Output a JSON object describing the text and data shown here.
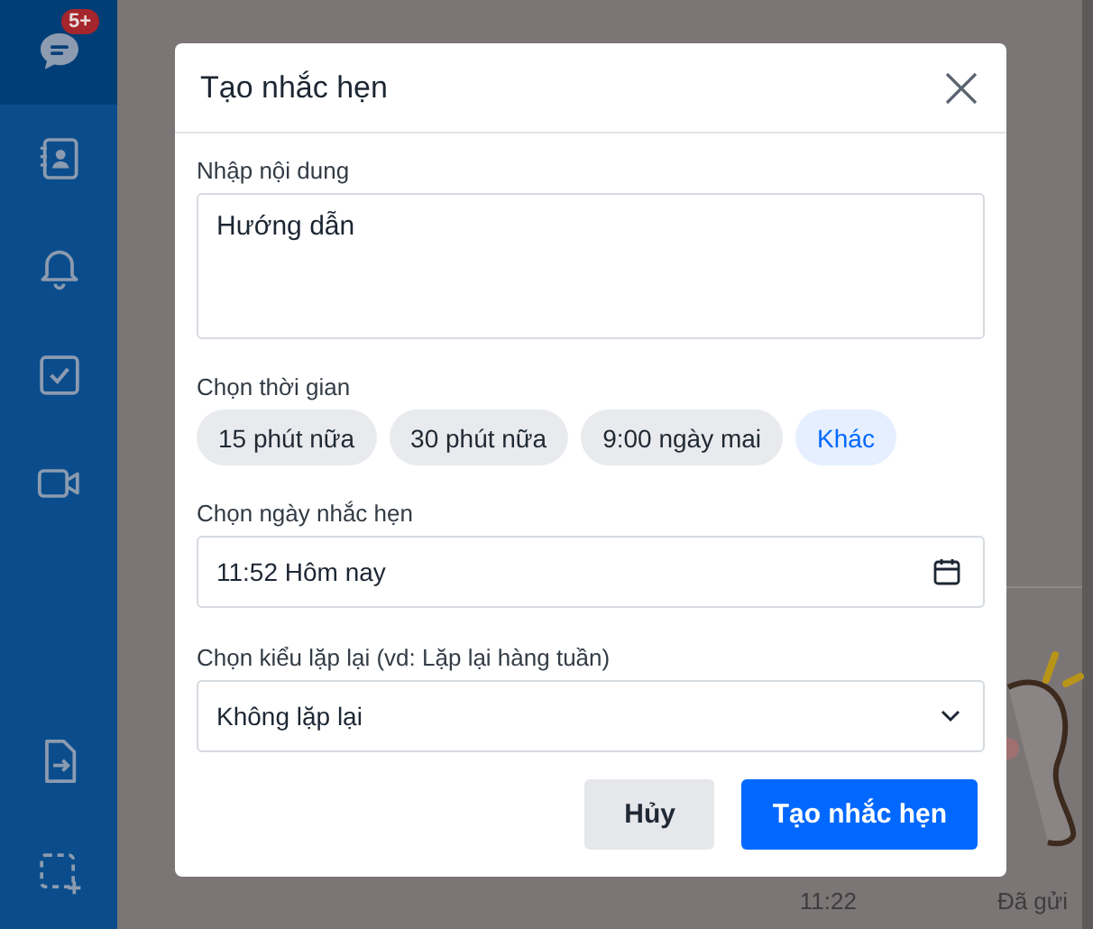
{
  "sidebar": {
    "top_items": [
      {
        "kind": "chat",
        "selected": true,
        "badge": "5+"
      },
      {
        "kind": "contacts",
        "selected": false
      },
      {
        "kind": "bell",
        "selected": false
      },
      {
        "kind": "todo",
        "selected": false
      },
      {
        "kind": "video",
        "selected": false
      }
    ],
    "bottom_items": [
      {
        "kind": "file",
        "selected": false
      },
      {
        "kind": "capture",
        "selected": false
      }
    ]
  },
  "chat": {
    "time": "11:22",
    "status": "Đã gửi"
  },
  "dialog": {
    "title": "Tạo nhắc hẹn",
    "content_label": "Nhập nội dung",
    "content_value": "Hướng dẫn",
    "time_label": "Chọn thời gian",
    "time_options": [
      {
        "label": "15 phút nữa",
        "selected": false
      },
      {
        "label": "30 phút nữa",
        "selected": false
      },
      {
        "label": "9:00 ngày mai",
        "selected": false
      },
      {
        "label": "Khác",
        "selected": true
      }
    ],
    "date_label": "Chọn ngày nhắc hẹn",
    "date_value": "11:52 Hôm nay",
    "repeat_label": "Chọn kiểu lặp lại (vd: Lặp lại hàng tuần)",
    "repeat_value": "Không lặp lại",
    "buttons": [
      {
        "label": "Hủy",
        "kind": "secondary"
      },
      {
        "label": "Tạo nhắc hẹn",
        "kind": "primary"
      }
    ]
  }
}
